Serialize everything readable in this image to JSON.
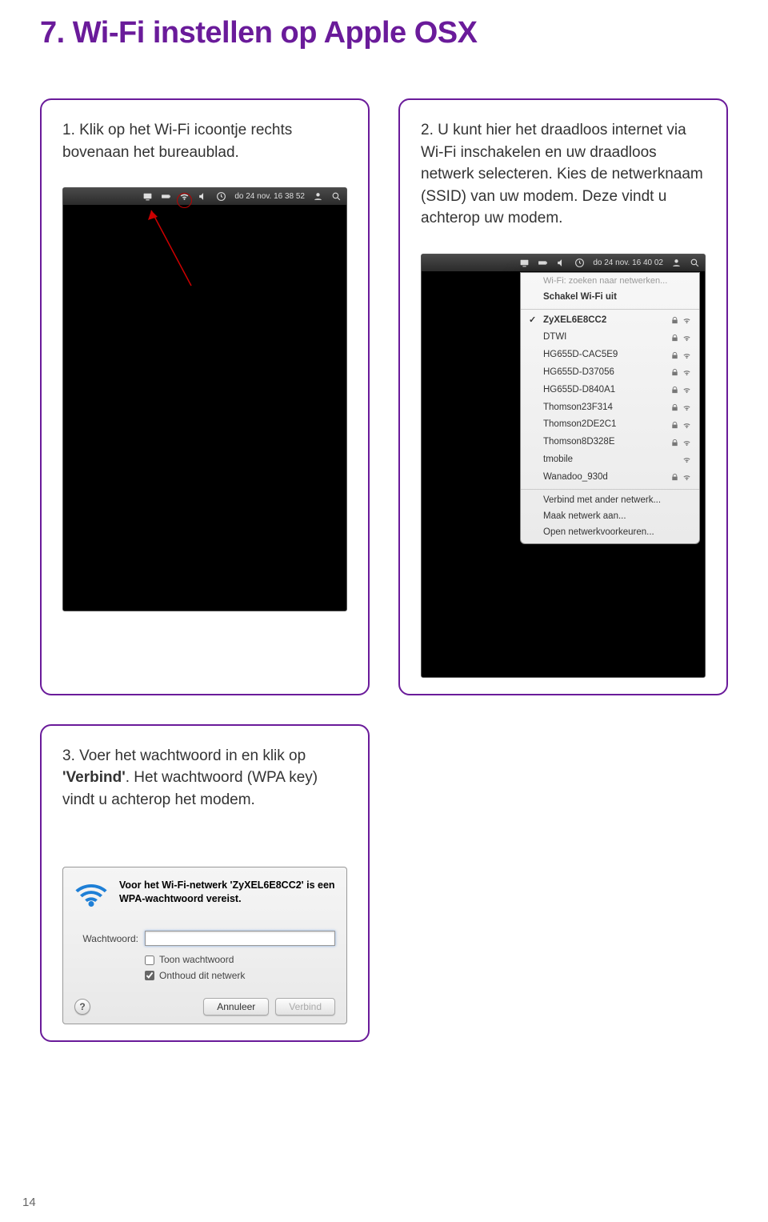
{
  "page": {
    "title": "7. Wi-Fi instellen op Apple OSX",
    "number": "14"
  },
  "step1": {
    "num": "1.",
    "text": " Klik op het Wi-Fi icoontje rechts bovenaan het bureaublad.",
    "menubar_time": "do 24 nov. 16 38 52"
  },
  "step2": {
    "num": "2.",
    "text": " U kunt hier het draadloos internet via Wi-Fi inschakelen en uw draadloos netwerk selecteren. Kies de netwerknaam (SSID) van uw modem. Deze vindt u achterop uw modem.",
    "menubar_time": "do 24 nov. 16 40 02",
    "dropdown": {
      "header": "Wi-Fi: zoeken naar netwerken...",
      "toggle": "Schakel Wi-Fi uit",
      "networks": [
        {
          "name": "ZyXEL6E8CC2",
          "locked": true,
          "selected": true
        },
        {
          "name": "DTWI",
          "locked": true
        },
        {
          "name": "HG655D-CAC5E9",
          "locked": true
        },
        {
          "name": "HG655D-D37056",
          "locked": true
        },
        {
          "name": "HG655D-D840A1",
          "locked": true
        },
        {
          "name": "Thomson23F314",
          "locked": true
        },
        {
          "name": "Thomson2DE2C1",
          "locked": true
        },
        {
          "name": "Thomson8D328E",
          "locked": true
        },
        {
          "name": "tmobile",
          "locked": false
        },
        {
          "name": "Wanadoo_930d",
          "locked": true
        }
      ],
      "actions": {
        "other": "Verbind met ander netwerk...",
        "create": "Maak netwerk aan...",
        "prefs": "Open netwerkvoorkeuren..."
      }
    }
  },
  "step3": {
    "num": "3.",
    "text_before": " Voer het wachtwoord in en klik op ",
    "bold": "'Verbind'",
    "text_after": ". Het wachtwoord (WPA key) vindt u achterop het modem.",
    "dialog": {
      "headline": "Voor het Wi-Fi-netwerk 'ZyXEL6E8CC2' is een WPA-wachtwoord vereist.",
      "password_label": "Wachtwoord:",
      "show_password": "Toon wachtwoord",
      "remember": "Onthoud dit netwerk",
      "cancel": "Annuleer",
      "connect": "Verbind"
    }
  }
}
